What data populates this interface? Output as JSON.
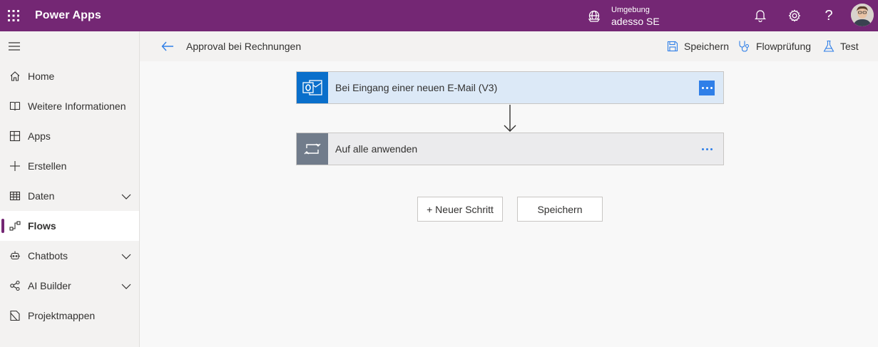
{
  "app": {
    "title": "Power Apps"
  },
  "environment": {
    "label": "Umgebung",
    "name": "adesso SE"
  },
  "header_icons": [
    "waffle-icon",
    "environment-icon",
    "bell-icon",
    "gear-icon",
    "help-icon"
  ],
  "help_glyph": "?",
  "sidebar": {
    "items": [
      {
        "label": "Home",
        "icon": "home-icon",
        "has_chevron": false,
        "active": false
      },
      {
        "label": "Weitere Informationen",
        "icon": "book-icon",
        "has_chevron": false,
        "active": false
      },
      {
        "label": "Apps",
        "icon": "apps-icon",
        "has_chevron": false,
        "active": false
      },
      {
        "label": "Erstellen",
        "icon": "plus-icon",
        "has_chevron": false,
        "active": false
      },
      {
        "label": "Daten",
        "icon": "table-icon",
        "has_chevron": true,
        "active": false
      },
      {
        "label": "Flows",
        "icon": "flow-icon",
        "has_chevron": false,
        "active": true
      },
      {
        "label": "Chatbots",
        "icon": "bot-icon",
        "has_chevron": true,
        "active": false
      },
      {
        "label": "AI Builder",
        "icon": "ai-icon",
        "has_chevron": true,
        "active": false
      },
      {
        "label": "Projektmappen",
        "icon": "solution-icon",
        "has_chevron": false,
        "active": false
      }
    ]
  },
  "commandbar": {
    "flow_title": "Approval bei Rechnungen",
    "save_label": "Speichern",
    "checker_label": "Flowprüfung",
    "test_label": "Test"
  },
  "flow": {
    "steps": [
      {
        "label": "Bei Eingang einer neuen E-Mail (V3)",
        "icon": "outlook-icon"
      },
      {
        "label": "Auf alle anwenden",
        "icon": "loop-icon"
      }
    ],
    "new_step_label": "+ Neuer Schritt",
    "save_button_label": "Speichern"
  },
  "colors": {
    "brand": "#742774",
    "trigger_bg": "#dce9f7",
    "outlook_blue": "#0a6fcb",
    "loop_gray": "#717c8b",
    "accent_blue": "#2f7fe8"
  }
}
